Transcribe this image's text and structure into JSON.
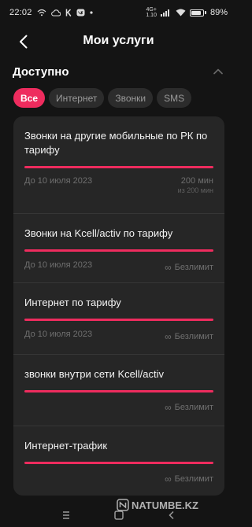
{
  "status_bar": {
    "time": "22:02",
    "icons": [
      "wifi-calling-icon",
      "cloud-icon",
      "kaspi-k-icon",
      "vk-icon",
      "dot-icon"
    ],
    "network_type": "4G+",
    "network_speed": "1.10",
    "battery_percent": "89%",
    "battery_level": 0.89
  },
  "header": {
    "title": "Мои услуги"
  },
  "section": {
    "title": "Доступно"
  },
  "filters": [
    {
      "label": "Все",
      "active": true
    },
    {
      "label": "Интернет",
      "active": false
    },
    {
      "label": "Звонки",
      "active": false
    },
    {
      "label": "SMS",
      "active": false
    }
  ],
  "services": [
    {
      "title": "Звонки на другие мобильные по РК по тарифу",
      "progress": 1.0,
      "date": "До 10 июля 2023",
      "value": "200 мин",
      "sub": "из 200 мин"
    },
    {
      "title": "Звонки на Kcell/activ по тарифу",
      "progress": 1.0,
      "date": "До 10 июля 2023",
      "value": "Безлимит"
    },
    {
      "title": "Интернет по тарифу",
      "progress": 1.0,
      "date": "До 10 июля 2023",
      "value": "Безлимит"
    },
    {
      "title": "звонки внутри сети Kcell/activ",
      "progress": 1.0,
      "date": "",
      "value": "Безлимит"
    },
    {
      "title": "Интернет-трафик",
      "progress": 1.0,
      "date": "",
      "value": "Безлимит"
    }
  ],
  "unlimited_symbol": "∞",
  "watermark": {
    "text": "NATUMBE.KZ"
  },
  "colors": {
    "accent": "#ee2c5e",
    "background": "#141414",
    "card": "#262626"
  }
}
